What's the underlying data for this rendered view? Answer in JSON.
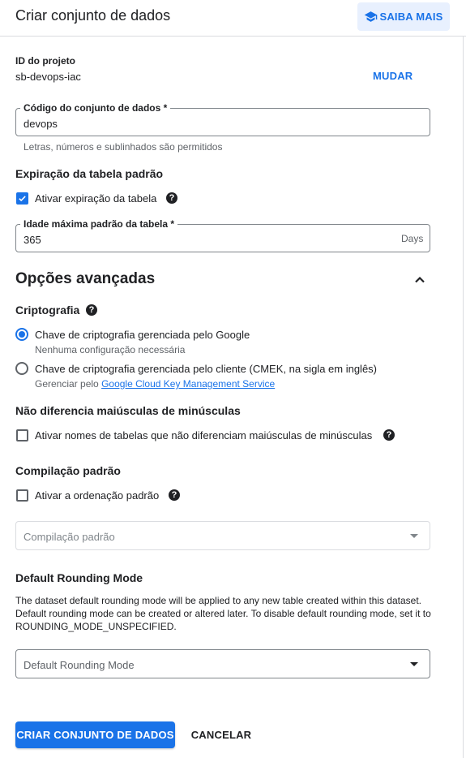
{
  "header": {
    "title": "Criar conjunto de dados",
    "learn_more": "SAIBA MAIS",
    "learn_icon": "school-icon"
  },
  "project": {
    "label": "ID do projeto",
    "value": "sb-devops-iac",
    "change": "MUDAR"
  },
  "dataset_id": {
    "label": "Código do conjunto de dados *",
    "value": "devops",
    "hint": "Letras, números e sublinhados são permitidos"
  },
  "expiration": {
    "heading": "Expiração da tabela padrão",
    "checkbox_label": "Ativar expiração da tabela",
    "checked": true,
    "max_age_label": "Idade máxima padrão da tabela *",
    "max_age_value": "365",
    "max_age_suffix": "Days"
  },
  "advanced": {
    "heading": "Opções avançadas",
    "expanded": true
  },
  "encryption": {
    "heading": "Criptografia",
    "options": [
      {
        "label": "Chave de criptografia gerenciada pelo Google",
        "sub": "Nenhuma configuração necessária",
        "selected": true
      },
      {
        "label": "Chave de criptografia gerenciada pelo cliente (CMEK, na sigla em inglês)",
        "sub_prefix": "Gerenciar pelo",
        "sub_link": "Google Cloud Key Management Service",
        "selected": false
      }
    ]
  },
  "case_insensitive": {
    "heading": "Não diferencia maiúsculas de minúsculas",
    "checkbox_label": "Ativar nomes de tabelas que não diferenciam maiúsculas de minúsculas",
    "checked": false
  },
  "collation": {
    "heading": "Compilação padrão",
    "checkbox_label": "Ativar a ordenação padrão",
    "checked": false,
    "select_placeholder": "Compilação padrão"
  },
  "rounding": {
    "heading": "Default Rounding Mode",
    "description": "The dataset default rounding mode will be applied to any new table created within this dataset. Default rounding mode can be created or altered later. To disable default rounding mode, set it to ROUNDING_MODE_UNSPECIFIED.",
    "select_placeholder": "Default Rounding Mode"
  },
  "footer": {
    "create": "CRIAR CONJUNTO DE DADOS",
    "cancel": "CANCELAR"
  },
  "colors": {
    "accent": "#1a73e8",
    "accent_light": "#e8f0fe",
    "text": "#202124",
    "muted": "#5f6368"
  }
}
